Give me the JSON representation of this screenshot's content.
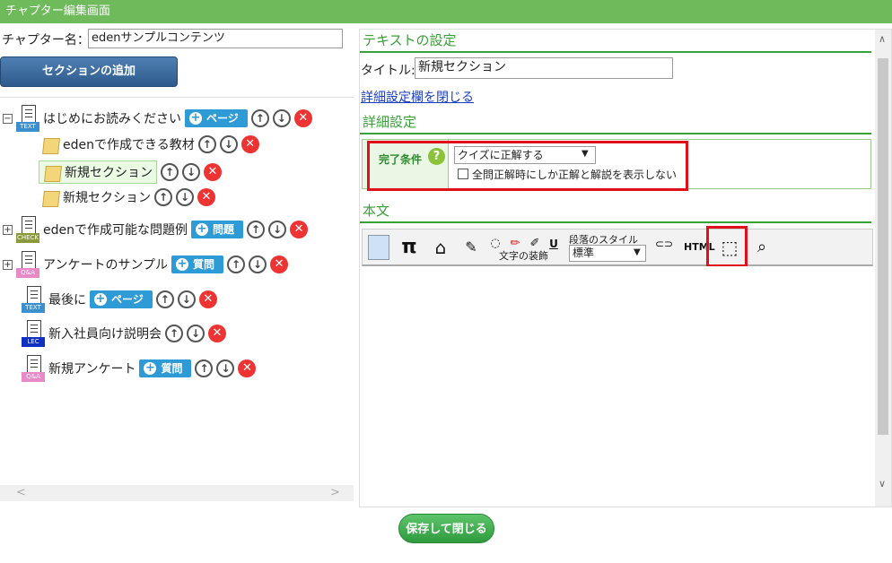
{
  "window": {
    "title": "チャプター編集画面"
  },
  "chapter": {
    "name_label": "チャプター名：",
    "name_value": "edenサンプルコンテンツ"
  },
  "add_section_button": "セクションの追加",
  "tree": {
    "items": [
      {
        "label": "はじめにお読みください",
        "tag": "TEXT",
        "pill": "ページ"
      },
      {
        "label": "edenで作成できる教材"
      },
      {
        "label": "新規セクション"
      },
      {
        "label": "新規セクション"
      },
      {
        "label": "edenで作成可能な問題例",
        "tag": "CHECK",
        "pill": "問題"
      },
      {
        "label": "アンケートのサンプル",
        "tag": "Q&A",
        "pill": "質問"
      },
      {
        "label": "最後に",
        "tag": "TEXT",
        "pill": "ページ"
      },
      {
        "label": "新入社員向け説明会",
        "tag": "LEC"
      },
      {
        "label": "新規アンケート",
        "tag": "Q&A",
        "pill": "質問"
      }
    ],
    "expander_minus": "−",
    "expander_plus": "+",
    "up_arrow": "↑",
    "down_arrow": "↓",
    "delete_mark": "✕"
  },
  "scroll": {
    "left": "<",
    "right": ">",
    "down": "∨",
    "up": "∧"
  },
  "text_settings": {
    "heading": "テキストの設定",
    "title_label": "タイトル:",
    "title_value": "新規セクション",
    "close_detail_link": "詳細設定欄を閉じる"
  },
  "detail": {
    "heading": "詳細設定",
    "completion_label": "完了条件",
    "help": "?",
    "completion_select": "クイズに正解する",
    "checkbox_label": "全問正解時にしか正解と解説を表示しない"
  },
  "body": {
    "heading": "本文"
  },
  "toolbar": {
    "pi": "π",
    "underline": "U",
    "decoration_label": "文字の装飾",
    "paragraph_style_label": "段落のスタイル",
    "paragraph_select": "標準",
    "html_label": "HTML",
    "link": "⊂⊃"
  },
  "save_button": "保存して閉じる",
  "colors": {
    "green": "#3aa03a",
    "titlebar": "#6fba5b",
    "pill": "#2e9ad6",
    "red": "#e0101a"
  }
}
